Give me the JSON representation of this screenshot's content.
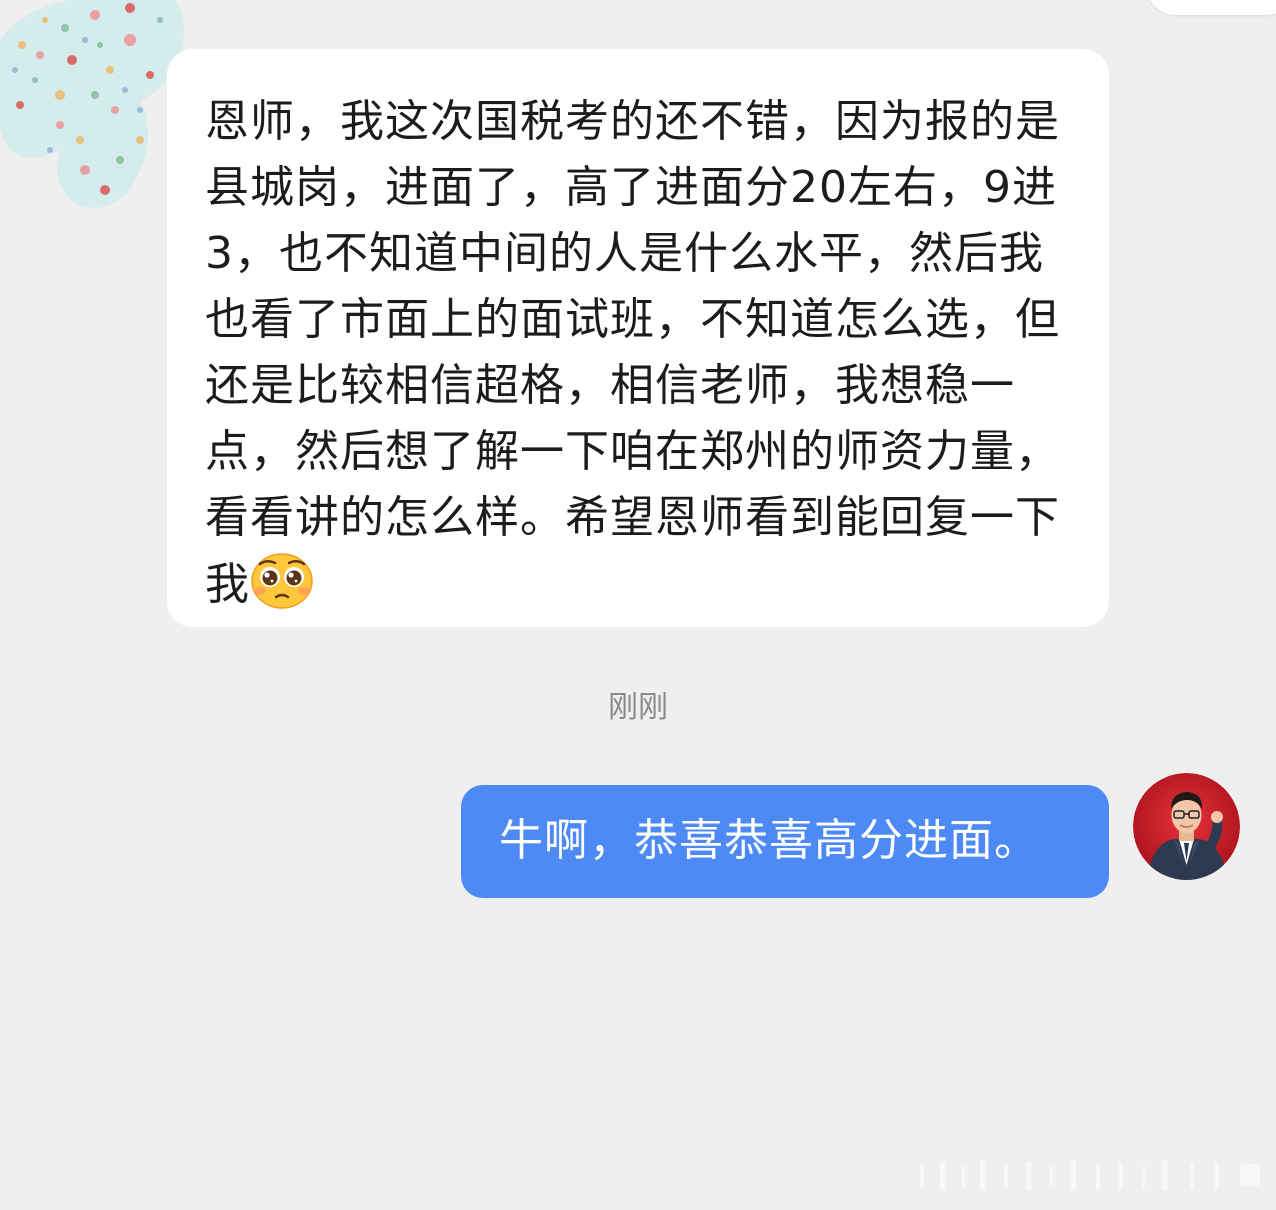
{
  "conversation": {
    "incoming": {
      "text": "恩师，我这次国税考的还不错，因为报的是县城岗，进面了，高了进面分20左右，9进3，也不知道中间的人是什么水平，然后我也看了市面上的面试班，不知道怎么选，但还是比较相信超格，相信老师，我想稳一点，然后想了解一下咱在郑州的师资力量，看看讲的怎么样。希望恩师看到能回复一下我",
      "emoji": "pleading-face-emoji"
    },
    "timestamp": "刚刚",
    "outgoing": {
      "text": "牛啊，恭喜恭喜高分进面。"
    }
  },
  "colors": {
    "background": "#efeff0",
    "incoming_bubble": "#ffffff",
    "outgoing_bubble": "#4d8af5",
    "timestamp_text": "#8a8a8a"
  }
}
